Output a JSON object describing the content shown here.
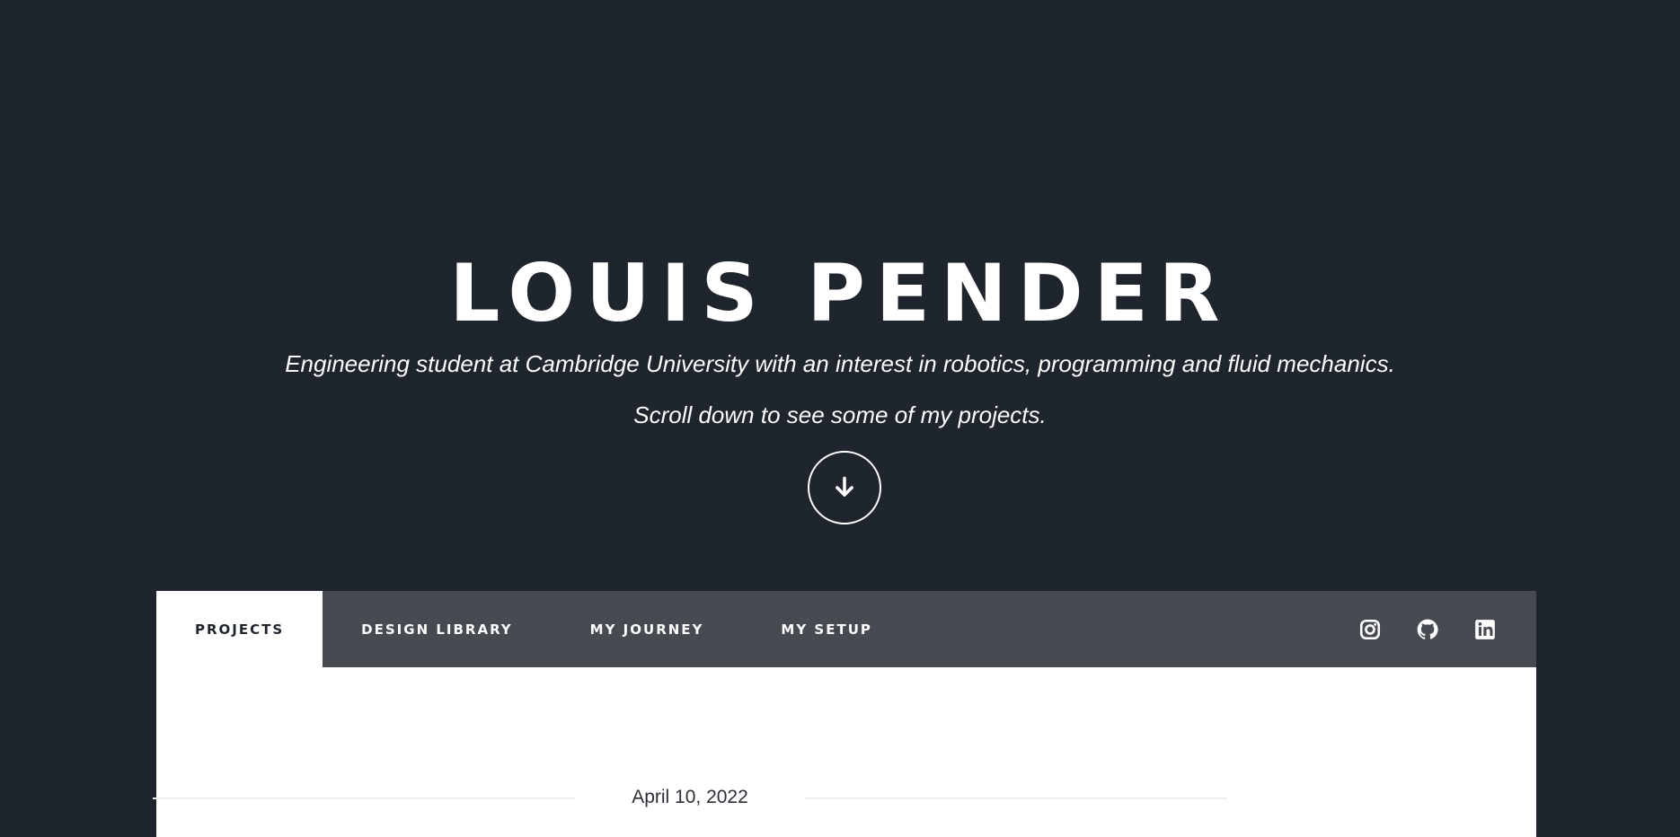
{
  "hero": {
    "name": "LOUIS PENDER",
    "tagline": "Engineering student at Cambridge University with an interest in robotics, programming and fluid mechanics.",
    "scroll_note": "Scroll down to see some of my projects.",
    "scroll_button_icon": "arrow-down-icon"
  },
  "nav": {
    "tabs": [
      {
        "label": "PROJECTS",
        "active": true
      },
      {
        "label": "DESIGN LIBRARY",
        "active": false
      },
      {
        "label": "MY JOURNEY",
        "active": false
      },
      {
        "label": "MY SETUP",
        "active": false
      }
    ],
    "social_icons": [
      "instagram-icon",
      "github-icon",
      "linkedin-icon"
    ]
  },
  "post": {
    "date": "April 10, 2022"
  },
  "colors": {
    "page_background": "#1f252d",
    "nav_background": "#464a51",
    "active_tab_background": "#ffffff",
    "text_light": "#ffffff",
    "text_dark": "#1f252d"
  }
}
